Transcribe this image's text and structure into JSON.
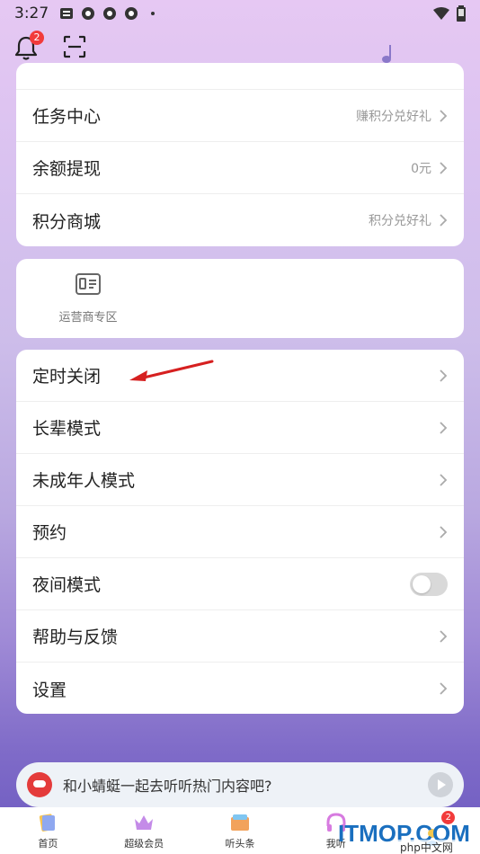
{
  "status": {
    "time": "3:27"
  },
  "header": {
    "bell_badge": "2"
  },
  "card1": {
    "rows": [
      {
        "label": "任务中心",
        "hint": "赚积分兑好礼"
      },
      {
        "label": "余额提现",
        "hint": "0元"
      },
      {
        "label": "积分商城",
        "hint": "积分兑好礼"
      }
    ]
  },
  "operator": {
    "label": "运营商专区"
  },
  "settings": {
    "rows": [
      {
        "label": "定时关闭"
      },
      {
        "label": "长辈模式"
      },
      {
        "label": "未成年人模式"
      },
      {
        "label": "预约"
      },
      {
        "label": "夜间模式",
        "toggle_on": false
      },
      {
        "label": "帮助与反馈"
      },
      {
        "label": "设置"
      }
    ]
  },
  "mini_player": {
    "text": "和小蜻蜓一起去听听热门内容吧?"
  },
  "bottom_nav": {
    "items": [
      {
        "label": "首页",
        "icon": "home-icon"
      },
      {
        "label": "超级会员",
        "icon": "crown-icon"
      },
      {
        "label": "听头条",
        "icon": "news-icon"
      },
      {
        "label": "我听",
        "icon": "headphones-icon"
      },
      {
        "label": "",
        "icon": "profile-icon",
        "badge": "2"
      }
    ]
  },
  "watermark": {
    "main": "ITMOP.COM",
    "sub": "php中文网"
  },
  "colors": {
    "accent_red": "#f23b3b",
    "annotation_arrow": "#d62020"
  }
}
